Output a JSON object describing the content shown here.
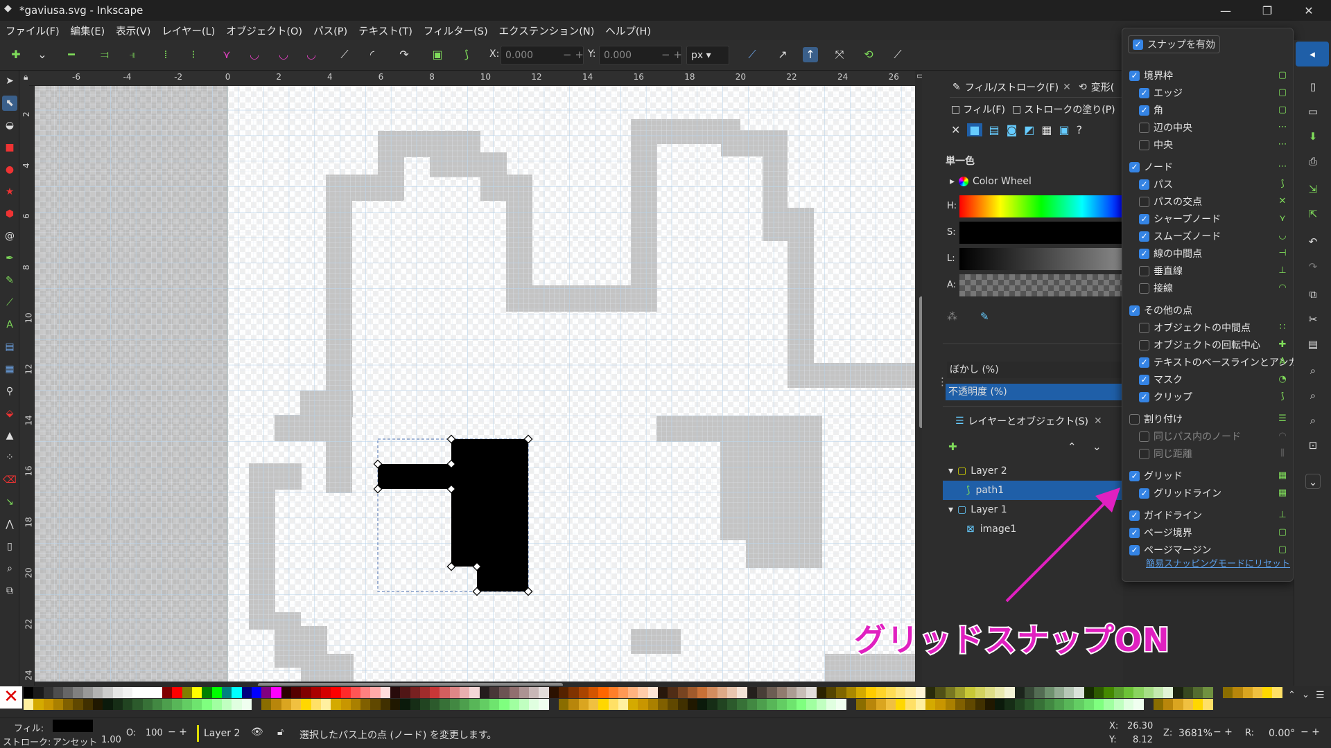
{
  "window": {
    "title": "*gaviusa.svg - Inkscape",
    "minimize": "—",
    "maximize": "❐",
    "close": "✕"
  },
  "menu": [
    "ファイル(F)",
    "編集(E)",
    "表示(V)",
    "レイヤー(L)",
    "オブジェクト(O)",
    "パス(P)",
    "テキスト(T)",
    "フィルター(S)",
    "エクステンション(N)",
    "ヘルプ(H)"
  ],
  "toolbar": {
    "x_label": "X:",
    "x_value": "0.000",
    "y_label": "Y:",
    "y_value": "0.000",
    "unit": "px"
  },
  "ruler": {
    "h_ticks": [
      "-6",
      "-4",
      "-2",
      "0",
      "2",
      "4",
      "6",
      "8",
      "10",
      "12",
      "14",
      "16",
      "18",
      "20",
      "22",
      "24",
      "26"
    ],
    "v_ticks": [
      "2",
      "4",
      "6",
      "8",
      "10",
      "12",
      "14",
      "16",
      "18",
      "20",
      "22",
      "24"
    ]
  },
  "fillstroke": {
    "tab_title": "フィル/ストローク(F)",
    "tab2_title": "変形(",
    "fill_tab": "フィル(F)",
    "stroke_paint_tab": "ストロークの塗り(P)",
    "flat_color": "単一色",
    "color_wheel": "Color Wheel",
    "h": "H:",
    "s": "S:",
    "l": "L:",
    "a": "A:",
    "blur": "ぼかし (%)",
    "opacity": "不透明度 (%)"
  },
  "layers": {
    "tab_title": "レイヤーとオブジェクト(S)",
    "items": [
      {
        "name": "Layer 2",
        "level": 0
      },
      {
        "name": "path1",
        "level": 1
      },
      {
        "name": "Layer 1",
        "level": 0
      },
      {
        "name": "image1",
        "level": 1
      }
    ]
  },
  "snap": {
    "enable": "スナップを有効",
    "rows": [
      {
        "label": "境界枠",
        "on": true,
        "indent": false,
        "dim": false
      },
      {
        "label": "エッジ",
        "on": true,
        "indent": true,
        "dim": false
      },
      {
        "label": "角",
        "on": true,
        "indent": true,
        "dim": false
      },
      {
        "label": "辺の中央",
        "on": false,
        "indent": true,
        "dim": false
      },
      {
        "label": "中央",
        "on": false,
        "indent": true,
        "dim": false
      },
      {
        "label": "ノード",
        "on": true,
        "indent": false,
        "dim": false
      },
      {
        "label": "パス",
        "on": true,
        "indent": true,
        "dim": false
      },
      {
        "label": "パスの交点",
        "on": false,
        "indent": true,
        "dim": false
      },
      {
        "label": "シャープノード",
        "on": true,
        "indent": true,
        "dim": false
      },
      {
        "label": "スムーズノード",
        "on": true,
        "indent": true,
        "dim": false
      },
      {
        "label": "線の中間点",
        "on": true,
        "indent": true,
        "dim": false
      },
      {
        "label": "垂直線",
        "on": false,
        "indent": true,
        "dim": false
      },
      {
        "label": "接線",
        "on": false,
        "indent": true,
        "dim": false
      },
      {
        "label": "その他の点",
        "on": true,
        "indent": false,
        "dim": false
      },
      {
        "label": "オブジェクトの中間点",
        "on": false,
        "indent": true,
        "dim": false
      },
      {
        "label": "オブジェクトの回転中心",
        "on": false,
        "indent": true,
        "dim": false
      },
      {
        "label": "テキストのベースラインとアンカー",
        "on": true,
        "indent": true,
        "dim": false
      },
      {
        "label": "マスク",
        "on": true,
        "indent": true,
        "dim": false
      },
      {
        "label": "クリップ",
        "on": true,
        "indent": true,
        "dim": false
      },
      {
        "label": "割り付け",
        "on": false,
        "indent": false,
        "dim": false
      },
      {
        "label": "同じパス内のノード",
        "on": false,
        "indent": true,
        "dim": true
      },
      {
        "label": "同じ距離",
        "on": false,
        "indent": true,
        "dim": true
      },
      {
        "label": "グリッド",
        "on": true,
        "indent": false,
        "dim": false
      },
      {
        "label": "グリッドライン",
        "on": true,
        "indent": true,
        "dim": false
      },
      {
        "label": "ガイドライン",
        "on": true,
        "indent": false,
        "dim": false
      },
      {
        "label": "ページ境界",
        "on": true,
        "indent": false,
        "dim": false
      },
      {
        "label": "ページマージン",
        "on": true,
        "indent": false,
        "dim": false
      }
    ],
    "reset_link": "簡易スナッピングモードにリセット"
  },
  "status": {
    "fill_label": "フィル:",
    "stroke_label": "ストローク:",
    "stroke_value": "アンセット",
    "stroke_width": "1.00",
    "opacity_label": "O:",
    "opacity_value": "100",
    "layer": "Layer 2",
    "message": "選択したパス上の点 (ノード) を変更します。",
    "x_label": "X:",
    "x_value": "26.30",
    "y_label": "Y:",
    "y_value": "8.12",
    "zoom_label": "Z:",
    "zoom_value": "3681%",
    "rotate_label": "R:",
    "rotate_value": "0.00°"
  },
  "annotation": {
    "text": "グリッドスナップON",
    "color": "#e020c0"
  },
  "colors": {
    "accent": "#3584e4",
    "selection": "#1f5fa8",
    "snap_icon": "#7fdc5a"
  }
}
